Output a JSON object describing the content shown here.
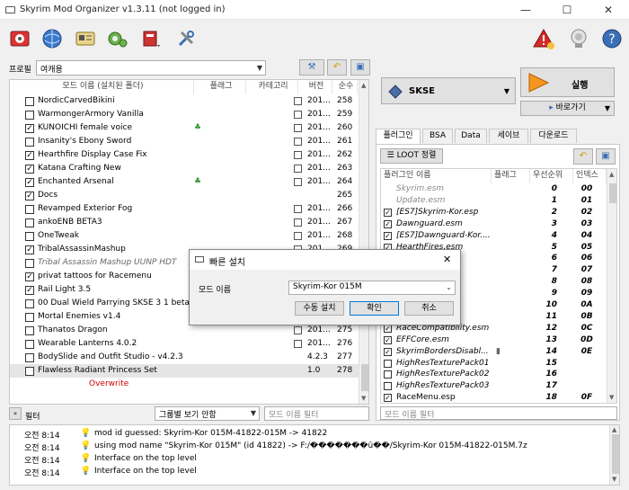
{
  "window": {
    "title": "Skyrim Mod Organizer v1.3.11 (not logged in)",
    "minimize": "—",
    "maximize": "☐",
    "close": "✕"
  },
  "toolbar": {
    "icons": [
      "instance-icon",
      "browser-icon",
      "profiles-icon",
      "executables-icon",
      "tools-icon",
      "settings-icon",
      "problems-icon",
      "endorse-icon",
      "help-icon"
    ]
  },
  "profile": {
    "label": "프로필",
    "value": "여캐용"
  },
  "mod_list": {
    "columns": [
      "모드 이름 (설치된 폴더)",
      "플래그",
      "카테고리",
      "버전",
      "순수"
    ],
    "rows": [
      {
        "name": "NordicCarvedBikini",
        "checked": false,
        "italic": false,
        "flag": "",
        "version": "201...",
        "prio": "258"
      },
      {
        "name": "WarmongerArmory Vanilla",
        "checked": false,
        "italic": false,
        "flag": "",
        "version": "201...",
        "prio": "259"
      },
      {
        "name": "KUNOICHI female voice",
        "checked": true,
        "italic": false,
        "flag": "♣",
        "version": "201...",
        "prio": "260"
      },
      {
        "name": "Insanity's Ebony Sword",
        "checked": false,
        "italic": false,
        "flag": "",
        "version": "201...",
        "prio": "261"
      },
      {
        "name": "Hearthfire Display Case Fix",
        "checked": true,
        "italic": false,
        "flag": "",
        "version": "201...",
        "prio": "262"
      },
      {
        "name": "Katana Crafting New",
        "checked": true,
        "italic": false,
        "flag": "",
        "version": "201...",
        "prio": "263"
      },
      {
        "name": "Enchanted Arsenal",
        "checked": true,
        "italic": false,
        "flag": "♣",
        "version": "201...",
        "prio": "264"
      },
      {
        "name": "Docs",
        "checked": true,
        "italic": false,
        "flag": "",
        "version": "",
        "prio": "265"
      },
      {
        "name": "Revamped Exterior Fog",
        "checked": false,
        "italic": false,
        "flag": "",
        "version": "201...",
        "prio": "266"
      },
      {
        "name": "ankoENB BETA3",
        "checked": false,
        "italic": false,
        "flag": "",
        "version": "201...",
        "prio": "267"
      },
      {
        "name": "OneTweak",
        "checked": false,
        "italic": false,
        "flag": "",
        "version": "201...",
        "prio": "268"
      },
      {
        "name": "TribalAssassinMashup",
        "checked": true,
        "italic": false,
        "flag": "",
        "version": "201...",
        "prio": "269"
      },
      {
        "name": "Tribal Assassin Mashup UUNP HDT",
        "checked": false,
        "italic": true,
        "flag": "",
        "version": "",
        "prio": ""
      },
      {
        "name": "privat tattoos for Racemenu",
        "checked": true,
        "italic": false,
        "flag": "",
        "version": "",
        "prio": ""
      },
      {
        "name": "Rail Light 3.5",
        "checked": true,
        "italic": false,
        "flag": "",
        "version": "",
        "prio": ""
      },
      {
        "name": "00 Dual Wield Parrying SKSE 3 1 beta",
        "checked": false,
        "italic": false,
        "flag": "",
        "version": "",
        "prio": ""
      },
      {
        "name": "Mortal Enemies v1.4",
        "checked": false,
        "italic": false,
        "flag": "",
        "version": "",
        "prio": ""
      },
      {
        "name": "Thanatos Dragon",
        "checked": false,
        "italic": false,
        "flag": "",
        "version": "201...",
        "prio": "275"
      },
      {
        "name": "Wearable Lanterns 4.0.2",
        "checked": false,
        "italic": false,
        "flag": "",
        "version": "201...",
        "prio": "276"
      },
      {
        "name": "BodySlide and Outfit Studio - v4.2.3",
        "checked": false,
        "italic": false,
        "flag": "",
        "version": "4.2.3",
        "prio": "277"
      },
      {
        "name": "Flawless Radiant Princess Set",
        "checked": false,
        "italic": false,
        "flag": "",
        "version": "1.0",
        "prio": "278"
      }
    ],
    "overwrite": "Overwrite"
  },
  "filter": {
    "label": "필터",
    "group_value": "그룹별 보기 안함",
    "name_placeholder": "모드 이름 필터"
  },
  "executable": {
    "value": "SKSE",
    "run_label": "실행",
    "shortcut_label": "바로가기"
  },
  "right_tabs": [
    "플러그인",
    "BSA",
    "Data",
    "세이브",
    "다운로드"
  ],
  "loot_button": "LOOT 정렬",
  "plugins": {
    "columns": [
      "플러그인 이름",
      "플래그",
      "우선순위",
      "인덱스"
    ],
    "rows": [
      {
        "name": "Skyrim.esm",
        "checked": null,
        "italic": true,
        "grey": true,
        "prio": "0",
        "idx": "00",
        "flag": ""
      },
      {
        "name": "Update.esm",
        "checked": null,
        "italic": true,
        "grey": true,
        "prio": "1",
        "idx": "01",
        "flag": ""
      },
      {
        "name": "[ES7]Skyrim-Kor.esp",
        "checked": true,
        "italic": true,
        "grey": false,
        "prio": "2",
        "idx": "02",
        "flag": ""
      },
      {
        "name": "Dawnguard.esm",
        "checked": true,
        "italic": true,
        "grey": false,
        "prio": "3",
        "idx": "03",
        "flag": ""
      },
      {
        "name": "[ES7]Dawnguard-Kor....",
        "checked": true,
        "italic": true,
        "grey": false,
        "prio": "4",
        "idx": "04",
        "flag": ""
      },
      {
        "name": "HearthFires.esm",
        "checked": true,
        "italic": true,
        "grey": false,
        "prio": "5",
        "idx": "05",
        "flag": ""
      },
      {
        "name": "",
        "checked": true,
        "italic": true,
        "grey": false,
        "prio": "6",
        "idx": "06",
        "flag": ""
      },
      {
        "name": "",
        "checked": true,
        "italic": true,
        "grey": false,
        "prio": "7",
        "idx": "07",
        "flag": ""
      },
      {
        "name": "-Kor...",
        "checked": true,
        "italic": true,
        "grey": false,
        "prio": "8",
        "idx": "08",
        "flag": ""
      },
      {
        "name": "",
        "checked": true,
        "italic": true,
        "grey": false,
        "prio": "9",
        "idx": "09",
        "flag": ""
      },
      {
        "name": "esm",
        "checked": true,
        "italic": true,
        "grey": false,
        "prio": "10",
        "idx": "0A",
        "flag": ""
      },
      {
        "name": "",
        "checked": true,
        "italic": true,
        "grey": false,
        "prio": "11",
        "idx": "0B",
        "flag": ""
      },
      {
        "name": "RaceCompatibility.esm",
        "checked": true,
        "italic": true,
        "grey": false,
        "prio": "12",
        "idx": "0C",
        "flag": ""
      },
      {
        "name": "EFFCore.esm",
        "checked": true,
        "italic": true,
        "grey": false,
        "prio": "13",
        "idx": "0D",
        "flag": ""
      },
      {
        "name": "SkyrimBordersDisabl...",
        "checked": true,
        "italic": true,
        "grey": false,
        "prio": "14",
        "idx": "0E",
        "flag": "▮"
      },
      {
        "name": "HighResTexturePack01...",
        "checked": false,
        "italic": true,
        "grey": false,
        "prio": "15",
        "idx": "",
        "flag": ""
      },
      {
        "name": "HighResTexturePack02...",
        "checked": false,
        "italic": true,
        "grey": false,
        "prio": "16",
        "idx": "",
        "flag": ""
      },
      {
        "name": "HighResTexturePack03...",
        "checked": false,
        "italic": true,
        "grey": false,
        "prio": "17",
        "idx": "",
        "flag": ""
      },
      {
        "name": "RaceMenu.esp",
        "checked": true,
        "italic": false,
        "grey": false,
        "prio": "18",
        "idx": "0F",
        "flag": ""
      }
    ],
    "filter_placeholder": "모드 이름 필터"
  },
  "log": [
    {
      "time": "오전 8:14",
      "msg": "mod id guessed: Skyrim-Kor 015M-41822-015M -> 41822"
    },
    {
      "time": "오전 8:14",
      "msg": "using mod name \"Skyrim-Kor 015M\" (id 41822) -> F:/�������û��/Skyrim-Kor 015M-41822-015M.7z"
    },
    {
      "time": "오전 8:14",
      "msg": "Interface on the top level"
    },
    {
      "time": "오전 8:14",
      "msg": "Interface on the top level"
    }
  ],
  "dialog": {
    "title": "빠른 설치",
    "name_label": "모드 이름",
    "name_value": "Skyrim-Kor 015M",
    "manual_button": "수동 설치",
    "ok_button": "확인",
    "cancel_button": "취소",
    "close": "✕"
  },
  "colors": {
    "overwrite": "#cc0000",
    "run_button": "#f7961e",
    "selected_row": "#e5e5e5",
    "check_green": "#3a9b3a"
  }
}
